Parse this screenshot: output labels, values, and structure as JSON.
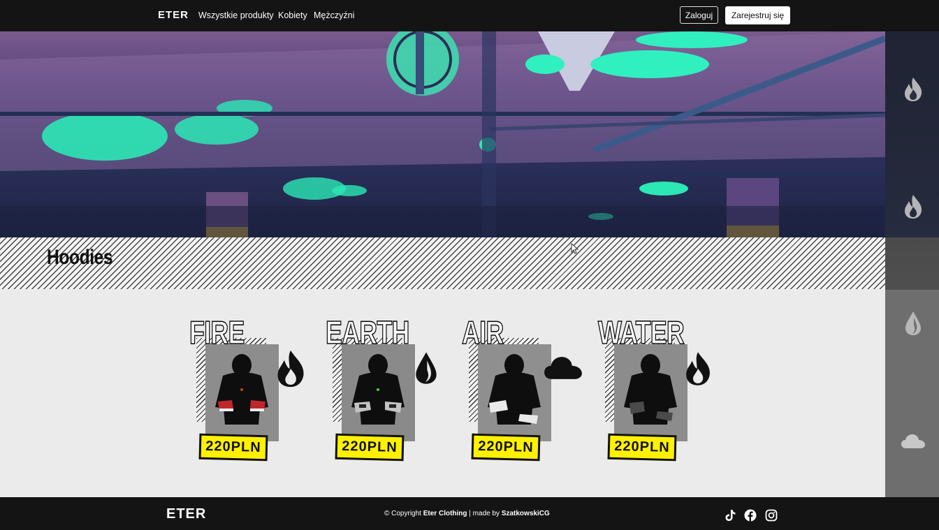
{
  "navbar": {
    "brand": "ETER",
    "links": [
      "Wszystkie produkty",
      "Kobiety",
      "Mężczyźni"
    ],
    "login_label": "Zaloguj",
    "register_label": "Zarejestruj się"
  },
  "section": {
    "title": "Hoodies"
  },
  "sidebar": {
    "icons": [
      "fire-icon",
      "earth-icon",
      "water-icon",
      "cloud-icon"
    ]
  },
  "products": [
    {
      "name": "FIRE",
      "price": "220PLN",
      "icon": "fire-icon",
      "shoe_color": "#c0262d"
    },
    {
      "name": "EARTH",
      "price": "220PLN",
      "icon": "earth-icon",
      "shoe_color": "#bfbfbf"
    },
    {
      "name": "AIR",
      "price": "220PLN",
      "icon": "cloud-icon",
      "shoe_color": "#e8e8e8"
    },
    {
      "name": "WATER",
      "price": "220PLN",
      "icon": "water-icon",
      "shoe_color": "#555555"
    }
  ],
  "footer": {
    "brand": "ETER",
    "copyright_prefix": "© Copyright",
    "company": "Eter Clothing",
    "separator": "| made by",
    "author": "SzatkowskiCG",
    "social": [
      "tiktok-icon",
      "facebook-icon",
      "instagram-icon"
    ]
  },
  "colors": {
    "accent_yellow": "#fff100",
    "dark": "#141414",
    "neon": "#2af5b8"
  }
}
